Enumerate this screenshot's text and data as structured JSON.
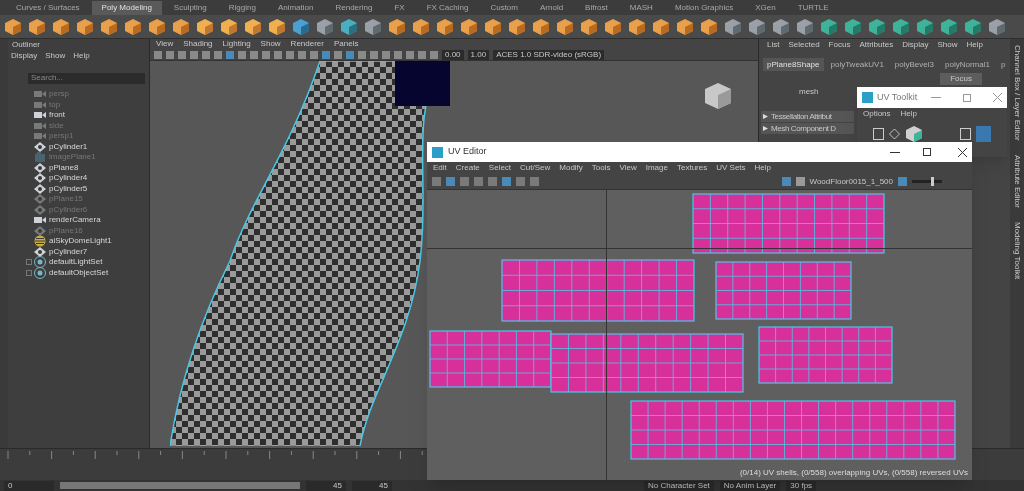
{
  "shelf_tabs": [
    {
      "label": "Curves / Surfaces",
      "selected": false
    },
    {
      "label": "Poly Modeling",
      "selected": true
    },
    {
      "label": "Sculpting",
      "selected": false
    },
    {
      "label": "Rigging",
      "selected": false
    },
    {
      "label": "Animation",
      "selected": false
    },
    {
      "label": "Rendering",
      "selected": false
    },
    {
      "label": "FX",
      "selected": false
    },
    {
      "label": "FX Caching",
      "selected": false
    },
    {
      "label": "Custom",
      "selected": false
    },
    {
      "label": "Arnold",
      "selected": false
    },
    {
      "label": "Bifrost",
      "selected": false
    },
    {
      "label": "MASH",
      "selected": false
    },
    {
      "label": "Motion Graphics",
      "selected": false
    },
    {
      "label": "XGen",
      "selected": false
    },
    {
      "label": "TURTLE",
      "selected": false
    }
  ],
  "outliner": {
    "title": "Outliner",
    "menu": [
      "Display",
      "Show",
      "Help"
    ],
    "search": {
      "placeholder": "Search..."
    },
    "items": [
      {
        "name": "persp",
        "kind": "camera",
        "hidden": true
      },
      {
        "name": "top",
        "kind": "camera",
        "hidden": true
      },
      {
        "name": "front",
        "kind": "camera",
        "hidden": false
      },
      {
        "name": "side",
        "kind": "camera",
        "hidden": true
      },
      {
        "name": "persp1",
        "kind": "camera",
        "hidden": true
      },
      {
        "name": "pCylinder1",
        "kind": "mesh",
        "hidden": false
      },
      {
        "name": "imagePlane1",
        "kind": "image",
        "hidden": true
      },
      {
        "name": "pPlane8",
        "kind": "mesh",
        "hidden": false
      },
      {
        "name": "pCylinder4",
        "kind": "mesh",
        "hidden": false
      },
      {
        "name": "pCylinder5",
        "kind": "mesh",
        "hidden": false
      },
      {
        "name": "pPlane15",
        "kind": "mesh",
        "hidden": true
      },
      {
        "name": "pCylinder6",
        "kind": "mesh",
        "hidden": true
      },
      {
        "name": "renderCamera",
        "kind": "camera",
        "hidden": false
      },
      {
        "name": "pPlane16",
        "kind": "mesh",
        "hidden": true
      },
      {
        "name": "aiSkyDomeLight1",
        "kind": "light",
        "hidden": false
      },
      {
        "name": "pCylinder7",
        "kind": "mesh",
        "hidden": false
      },
      {
        "name": "defaultLightSet",
        "kind": "set",
        "hidden": false
      },
      {
        "name": "defaultObjectSet",
        "kind": "set",
        "hidden": false
      }
    ]
  },
  "viewport": {
    "menu": [
      "View",
      "Shading",
      "Lighting",
      "Show",
      "Renderer",
      "Panels"
    ],
    "exposure": "0.00",
    "gamma": "1.00",
    "color_space": "ACES 1.0 SDR-video (sRGB)"
  },
  "channel_box": {
    "menu": [
      "List",
      "Selected",
      "Focus",
      "Attributes",
      "Display",
      "Show",
      "Help"
    ],
    "tabs": [
      {
        "label": "pPlane8Shape",
        "selected": true
      },
      {
        "label": "polyTweakUV1",
        "selected": false
      },
      {
        "label": "polyBevel3",
        "selected": false
      },
      {
        "label": "polyNormal1",
        "selected": false
      },
      {
        "label": "p",
        "selected": false
      }
    ],
    "focus_button": "Focus",
    "field_label": "mesh",
    "sections": [
      {
        "label": "Tessellation Attribut",
        "expanded": false
      },
      {
        "label": "Mesh Component D",
        "expanded": false
      }
    ]
  },
  "side_tabs": [
    "Channel Box / Layer Editor",
    "Attribute Editor",
    "Modeling Toolkit"
  ],
  "uv_toolkit": {
    "title": "UV Toolkit",
    "menu": [
      "Options",
      "Help"
    ]
  },
  "uv_editor": {
    "title": "UV Editor",
    "menu": [
      "Edit",
      "Create",
      "Select",
      "Cut/Sew",
      "Modify",
      "Tools",
      "View",
      "Image",
      "Textures",
      "UV Sets",
      "Help"
    ],
    "texture": "WoodFloor0015_1_500",
    "slider": {
      "level": 0.7
    },
    "status": "(0/14) UV shells, (0/558) overlapping UVs, (0/558) reversed UVs"
  },
  "range_bar": {
    "level": 1,
    "start": "0",
    "end": "45",
    "end2": "45",
    "character_set": "No Character Set",
    "anim_layer": "No Anim Layer",
    "fps": "30 fps"
  }
}
